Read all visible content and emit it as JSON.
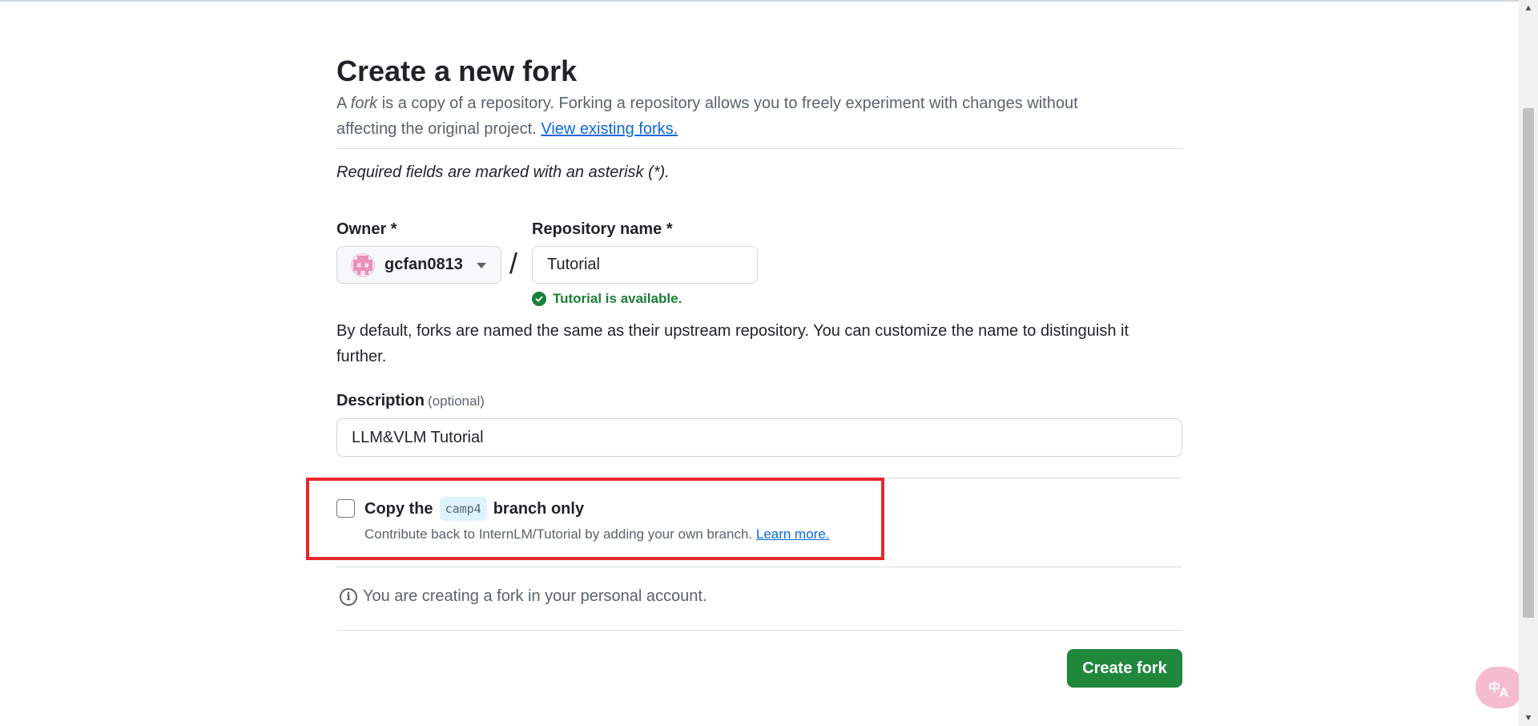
{
  "page": {
    "title": "Create a new fork",
    "intro_prefix": "A ",
    "intro_em": "fork",
    "intro_suffix": " is a copy of a repository. Forking a repository allows you to freely experiment with changes without affecting the original project. ",
    "intro_link": "View existing forks.",
    "required_note": "Required fields are marked with an asterisk (*)."
  },
  "owner": {
    "label": "Owner *",
    "value": "gcfan0813"
  },
  "repo": {
    "label": "Repository name *",
    "value": "Tutorial",
    "availability": "Tutorial is available."
  },
  "naming_note": "By default, forks are named the same as their upstream repository. You can customize the name to distinguish it further.",
  "description": {
    "label": "Description",
    "optional": "(optional)",
    "value": "LLM&VLM Tutorial"
  },
  "branch_option": {
    "checked": false,
    "prefix": "Copy the",
    "branch": "camp4",
    "suffix": "branch only",
    "help_text": "Contribute back to InternLM/Tutorial by adding your own branch. ",
    "help_link": "Learn more."
  },
  "info_text": "You are creating a fork in your personal account.",
  "submit_label": "Create fork",
  "colors": {
    "primary_green": "#1f883d",
    "link_blue": "#0969da",
    "highlight_red": "#e8262b",
    "success_green": "#1a7f37"
  },
  "icons": [
    "avatar-identicon",
    "caret-down-icon",
    "check-circle-icon",
    "info-icon",
    "translate-icon"
  ]
}
